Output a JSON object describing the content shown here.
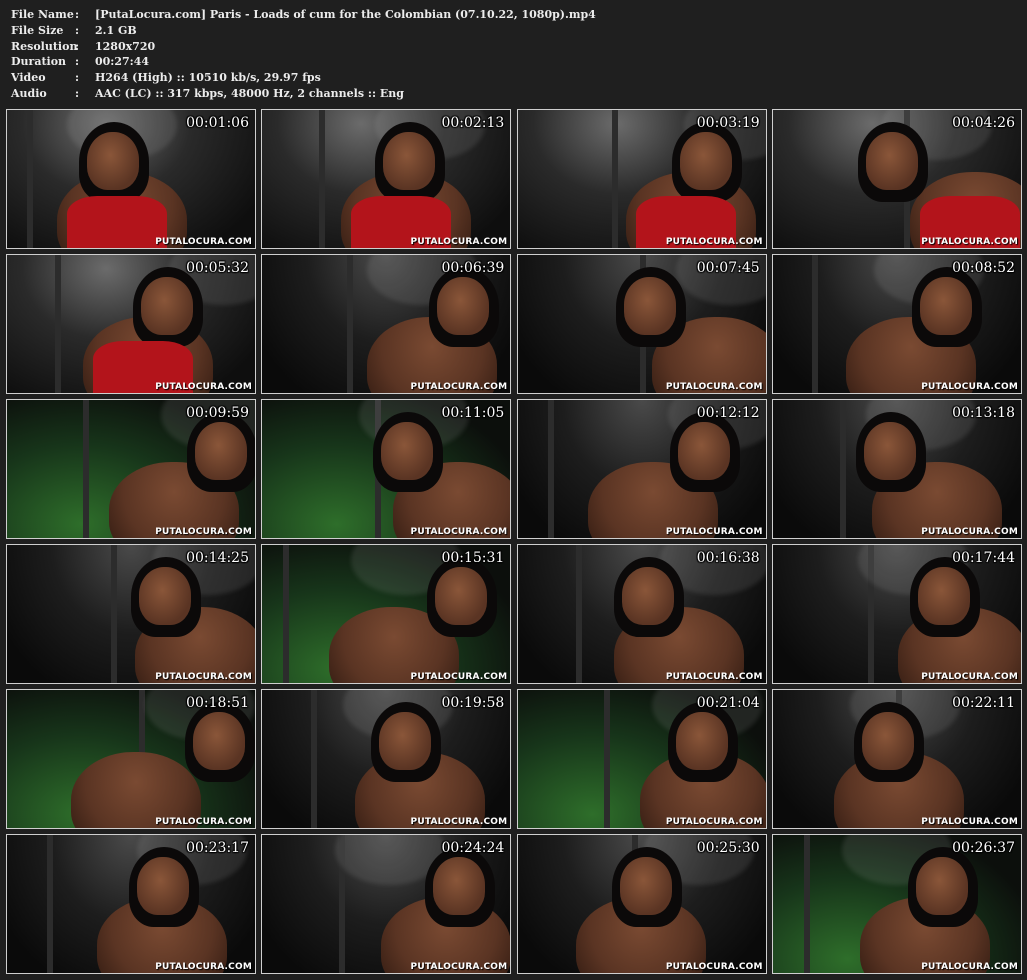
{
  "info": {
    "rows": [
      {
        "key": "File Name",
        "sep": ":",
        "value": "[PutaLocura.com] Paris - Loads of cum for the Colombian (07.10.22, 1080p).mp4"
      },
      {
        "key": "File Size",
        "sep": ":",
        "value": "2.1 GB"
      },
      {
        "key": "Resolution",
        "sep": ":",
        "value": "1280x720"
      },
      {
        "key": "Duration",
        "sep": ":",
        "value": "00:27:44"
      },
      {
        "key": "Video",
        "sep": ":",
        "value": "H264 (High) :: 10510 kb/s, 29.97 fps"
      },
      {
        "key": "Audio",
        "sep": ":",
        "value": "AAC (LC) :: 317 kbps, 48000 Hz, 2 channels :: Eng"
      }
    ]
  },
  "watermark": "PUTALOCURA.COM",
  "colors": {
    "background": "#1f1f1f",
    "text": "#ececec",
    "thumb_border": "#cfcfcf",
    "skin": "#5a3423",
    "garment": "#b3141b",
    "green_bg": "#2e6e2a"
  },
  "thumbnails": [
    {
      "time": "00:01:06",
      "scene": "red"
    },
    {
      "time": "00:02:13",
      "scene": "red"
    },
    {
      "time": "00:03:19",
      "scene": "red"
    },
    {
      "time": "00:04:26",
      "scene": "red"
    },
    {
      "time": "00:05:32",
      "scene": "red"
    },
    {
      "time": "00:06:39",
      "scene": "dark"
    },
    {
      "time": "00:07:45",
      "scene": "dark"
    },
    {
      "time": "00:08:52",
      "scene": "dark"
    },
    {
      "time": "00:09:59",
      "scene": "green"
    },
    {
      "time": "00:11:05",
      "scene": "green"
    },
    {
      "time": "00:12:12",
      "scene": "dark"
    },
    {
      "time": "00:13:18",
      "scene": "dark"
    },
    {
      "time": "00:14:25",
      "scene": "dark"
    },
    {
      "time": "00:15:31",
      "scene": "green"
    },
    {
      "time": "00:16:38",
      "scene": "dark"
    },
    {
      "time": "00:17:44",
      "scene": "dark"
    },
    {
      "time": "00:18:51",
      "scene": "green"
    },
    {
      "time": "00:19:58",
      "scene": "dark"
    },
    {
      "time": "00:21:04",
      "scene": "green"
    },
    {
      "time": "00:22:11",
      "scene": "dark"
    },
    {
      "time": "00:23:17",
      "scene": "dark"
    },
    {
      "time": "00:24:24",
      "scene": "dark"
    },
    {
      "time": "00:25:30",
      "scene": "dark"
    },
    {
      "time": "00:26:37",
      "scene": "green"
    }
  ]
}
